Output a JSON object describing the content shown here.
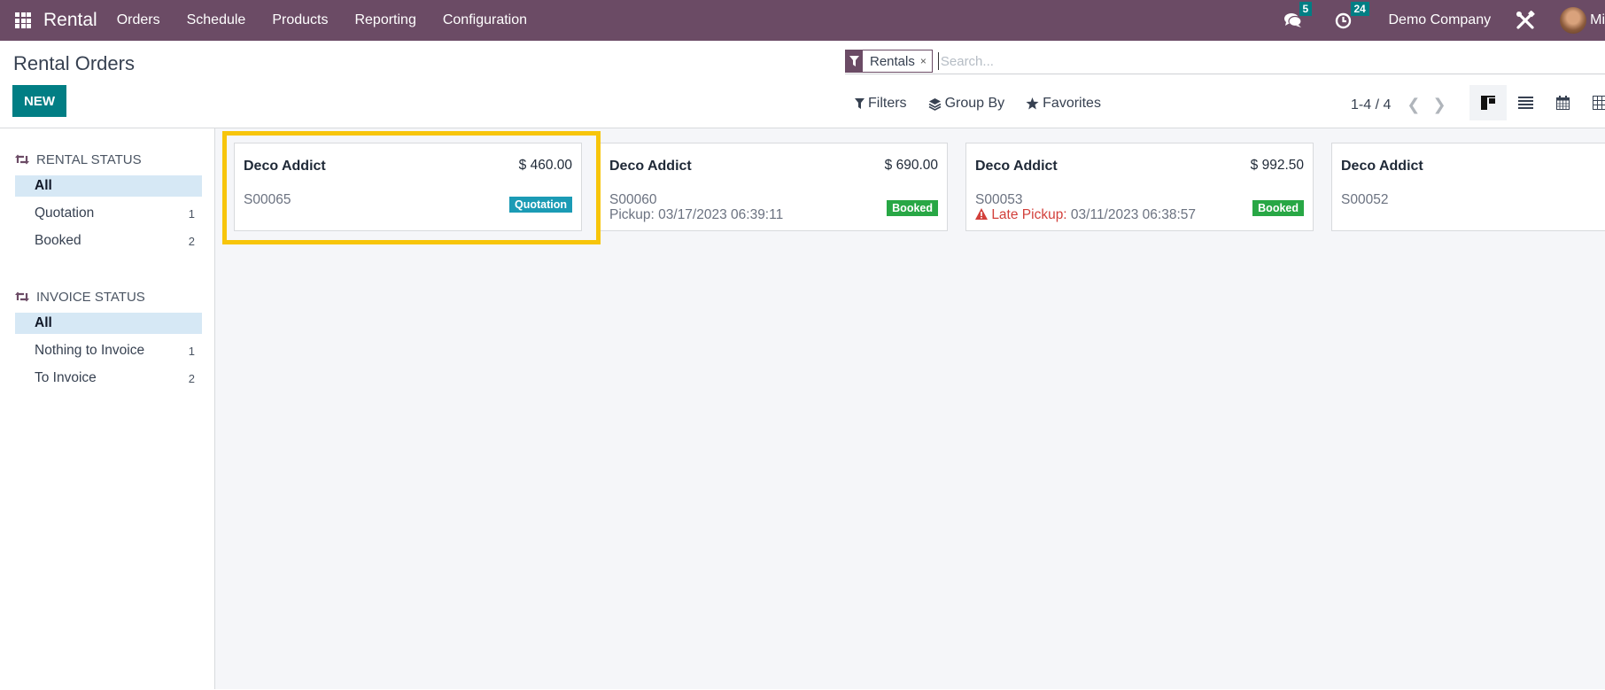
{
  "navbar": {
    "app_name": "Rental",
    "menu": [
      "Orders",
      "Schedule",
      "Products",
      "Reporting",
      "Configuration"
    ],
    "messages_count": "5",
    "activities_count": "24",
    "company": "Demo Company",
    "user_name_partial": "Mi",
    "icons": {
      "apps": "grid-icon",
      "messages": "chat-icon",
      "activities": "clock-icon",
      "debug": "tools-icon"
    }
  },
  "control_panel": {
    "title": "Rental Orders",
    "new_label": "NEW",
    "search": {
      "facet_label": "Rentals",
      "facet_close": "×",
      "placeholder": "Search..."
    },
    "filters_label": "Filters",
    "group_by_label": "Group By",
    "favorites_label": "Favorites",
    "pager": "1-4 / 4",
    "views": [
      "kanban",
      "list",
      "calendar",
      "pivot"
    ],
    "active_view": "kanban"
  },
  "sidebar": {
    "sections": [
      {
        "title": "RENTAL STATUS",
        "items": [
          {
            "label": "All",
            "count": "",
            "active": true
          },
          {
            "label": "Quotation",
            "count": "1",
            "active": false
          },
          {
            "label": "Booked",
            "count": "2",
            "active": false
          }
        ]
      },
      {
        "title": "INVOICE STATUS",
        "items": [
          {
            "label": "All",
            "count": "",
            "active": true
          },
          {
            "label": "Nothing to Invoice",
            "count": "1",
            "active": false
          },
          {
            "label": "To Invoice",
            "count": "2",
            "active": false
          }
        ]
      }
    ]
  },
  "cards": [
    {
      "customer": "Deco Addict",
      "amount": "$ 460.00",
      "ref": "S00065",
      "sub_label": "",
      "sub_date": "",
      "late": false,
      "tag": "Quotation",
      "tag_color": "#1b9bb5",
      "highlighted": true
    },
    {
      "customer": "Deco Addict",
      "amount": "$ 690.00",
      "ref": "S00060",
      "sub_label": "Pickup: ",
      "sub_date": "03/17/2023 06:39:11",
      "late": false,
      "tag": "Booked",
      "tag_color": "#28a745",
      "highlighted": false
    },
    {
      "customer": "Deco Addict",
      "amount": "$ 992.50",
      "ref": "S00053",
      "sub_label": "Late Pickup: ",
      "sub_date": "03/11/2023 06:38:57",
      "late": true,
      "tag": "Booked",
      "tag_color": "#28a745",
      "highlighted": false
    },
    {
      "customer": "Deco Addict",
      "amount": "$",
      "ref": "S00052",
      "sub_label": "",
      "sub_date": "",
      "late": false,
      "tag": "",
      "tag_color": "",
      "highlighted": false
    }
  ],
  "colors": {
    "brand": "#6b4b65",
    "primary": "#017e84",
    "highlight": "#f7c50b"
  }
}
